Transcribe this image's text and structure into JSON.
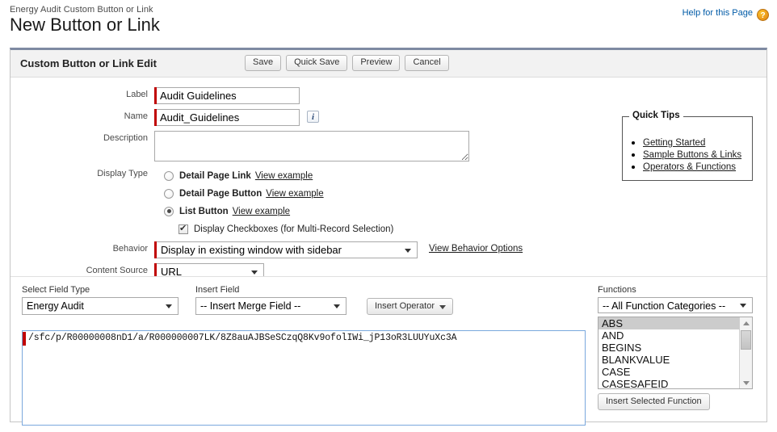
{
  "header": {
    "breadcrumb": "Energy Audit Custom Button or Link",
    "title": "New Button or Link",
    "help_label": "Help for this Page",
    "help_icon_glyph": "?"
  },
  "panel": {
    "title": "Custom Button or Link Edit",
    "buttons": [
      {
        "label": "Save",
        "name": "save-button"
      },
      {
        "label": "Quick Save",
        "name": "quick-save-button"
      },
      {
        "label": "Preview",
        "name": "preview-button"
      },
      {
        "label": "Cancel",
        "name": "cancel-button"
      }
    ]
  },
  "form": {
    "label_field": {
      "label": "Label",
      "value": "Audit Guidelines"
    },
    "name_field": {
      "label": "Name",
      "value": "Audit_Guidelines",
      "info_glyph": "i"
    },
    "description_field": {
      "label": "Description",
      "value": "",
      "placeholder": ""
    },
    "display_type": {
      "label": "Display Type",
      "options": [
        {
          "label": "Detail Page Link",
          "link": "View example",
          "selected": false
        },
        {
          "label": "Detail Page Button",
          "link": "View example",
          "selected": false
        },
        {
          "label": "List Button",
          "link": "View example",
          "selected": true
        }
      ],
      "checkbox": {
        "label": "Display Checkboxes (for Multi-Record Selection)",
        "checked": true
      }
    },
    "behavior": {
      "label": "Behavior",
      "value": "Display in existing window with sidebar",
      "link": "View Behavior Options"
    },
    "content_source": {
      "label": "Content Source",
      "value": "URL"
    }
  },
  "quick_tips": {
    "legend": "Quick Tips",
    "links": [
      "Getting Started",
      "Sample Buttons & Links",
      "Operators & Functions"
    ]
  },
  "formula_editor": {
    "select_field_type": {
      "caption": "Select Field Type",
      "value": "Energy Audit"
    },
    "insert_field": {
      "caption": "Insert Field",
      "value": "-- Insert Merge Field --"
    },
    "insert_operator": {
      "label": "Insert Operator"
    },
    "formula_value": "/sfc/p/R00000008nD1/a/R000000007LK/8Z8auAJBSeSCzqQ8Kv9ofolIWi_jP13oR3LUUYuXc3A",
    "functions": {
      "caption": "Functions",
      "category_value": "-- All Function Categories --",
      "items": [
        "ABS",
        "AND",
        "BEGINS",
        "BLANKVALUE",
        "CASE",
        "CASESAFEID"
      ],
      "selected_index": 0,
      "insert_button": "Insert Selected Function"
    }
  },
  "colors": {
    "required_bar": "#c00000",
    "panel_top_rule": "#7e8aa2",
    "link": "#015ba7",
    "focus_border": "#7aa8dd"
  }
}
